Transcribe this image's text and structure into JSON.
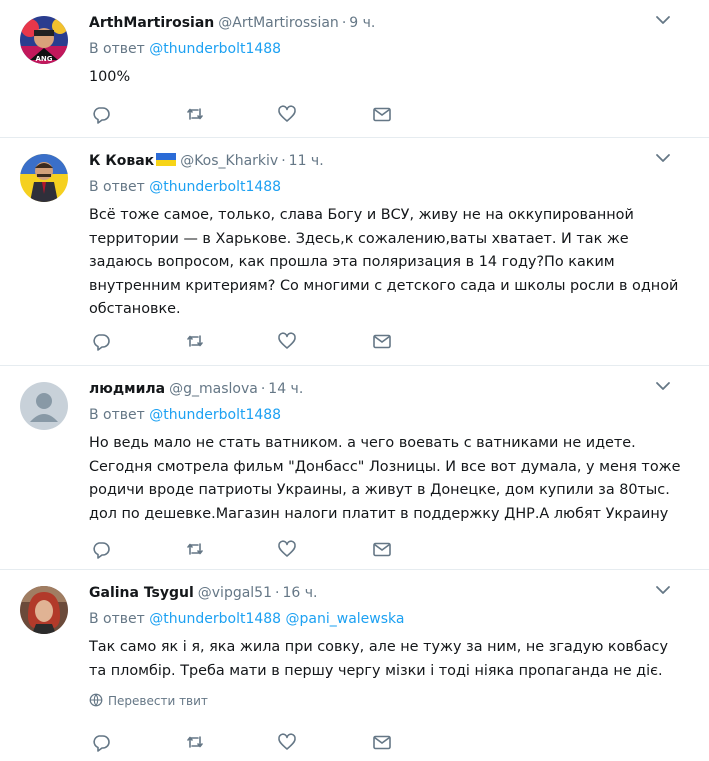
{
  "colors": {
    "link": "#1da1f2",
    "muted": "#657786",
    "text": "#14171a",
    "divider": "#e6ecf0"
  },
  "icons": {
    "reply": "reply-icon",
    "retweet": "retweet-icon",
    "like": "heart-icon",
    "dm": "envelope-icon",
    "more": "chevron-down-icon",
    "translate": "globe-icon"
  },
  "tweets": [
    {
      "fullname": "ArthMartirosian",
      "handle": "@ArtMartirossian",
      "sep": "·",
      "time": "9 ч.",
      "reply_prefix": "В ответ",
      "mentions": [
        "@thunderbolt1488"
      ],
      "text": "100%"
    },
    {
      "fullname": "К Ковак",
      "handle": "@Kos_Kharkiv",
      "sep": "·",
      "time": "11 ч.",
      "reply_prefix": "В ответ",
      "mentions": [
        "@thunderbolt1488"
      ],
      "text": "Всё тоже самое, только, слава Богу и ВСУ, живу не на оккупированной территории — в Харькове. Здесь,к сожалению,ваты хватает. И так же задаюсь вопросом, как прошла эта поляризация в 14 году?По каким внутренним критериям? Со многими с детского сада и школы росли в одной обстановке."
    },
    {
      "fullname": "людмила",
      "handle": "@g_maslova",
      "sep": "·",
      "time": "14 ч.",
      "reply_prefix": "В ответ",
      "mentions": [
        "@thunderbolt1488"
      ],
      "text": "Но ведь мало не стать ватником. а чего воевать с ватниками не идете. Сегодня смотрела фильм \"Донбасс\" Лозницы. И все вот думала, у меня тоже родичи вроде патриоты Украины, а живут в Донецке, дом купили за 80тыс. дол по дешевке.Магазин налоги платит в поддержку ДНР.А любят Украину"
    },
    {
      "fullname": "Galina Tsygul",
      "handle": "@vipgal51",
      "sep": "·",
      "time": "16 ч.",
      "reply_prefix": "В ответ",
      "mentions": [
        "@thunderbolt1488",
        "@pani_walewska"
      ],
      "text": "Так само як і я, яка жила при совку, але не тужу за ним, не згадую ковбасу та пломбір. Треба мати в першу чергу мізки і тоді ніяка пропаганда не діє.",
      "translate_label": "Перевести твит"
    }
  ]
}
